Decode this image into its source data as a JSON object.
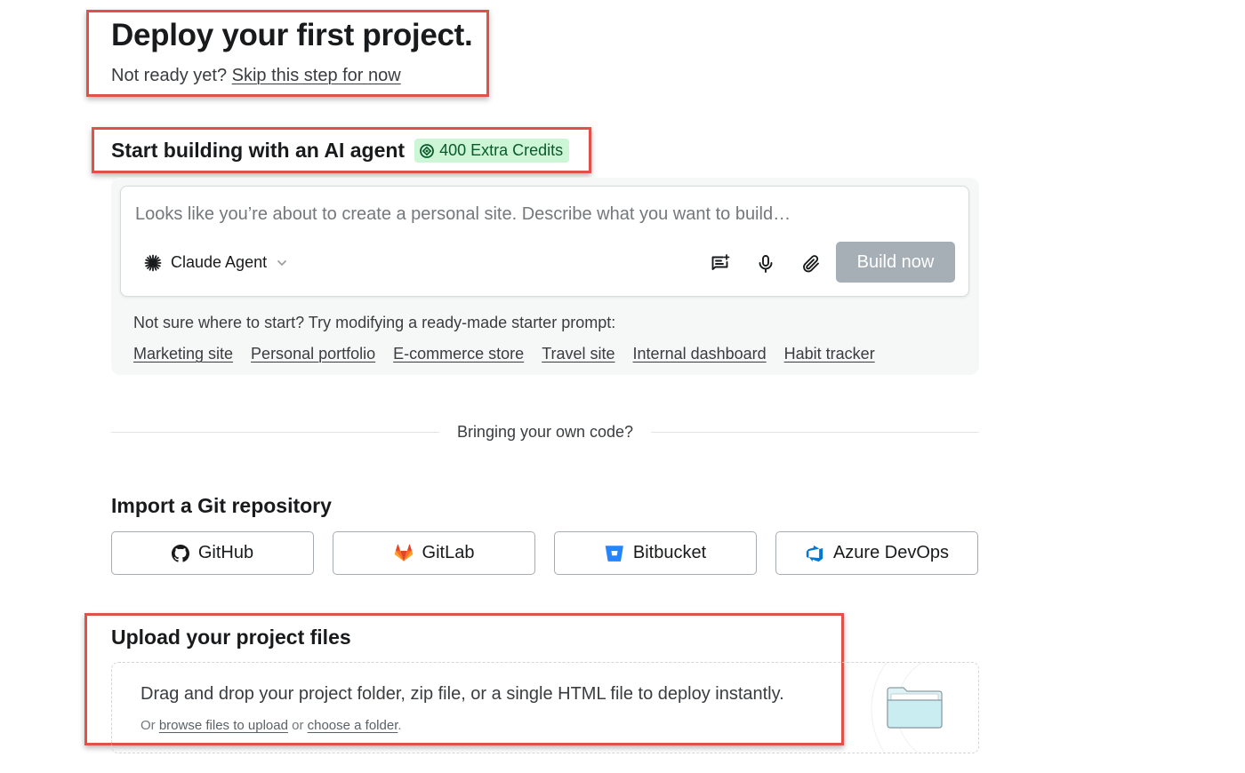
{
  "header": {
    "title": "Deploy your first project.",
    "subtitle_prefix": "Not ready yet? ",
    "skip_link": "Skip this step for now"
  },
  "ai_agent": {
    "heading": "Start building with an AI agent",
    "credits_badge": "400 Extra Credits",
    "badge_icon": "credit-coin-icon",
    "prompt_placeholder": "Looks like you’re about to create a personal site. Describe what you want to build…",
    "agent_name": "Claude Agent",
    "agent_icon": "claude-asterisk-icon",
    "build_button": "Build now",
    "toolbar_icons": [
      "prompt-enhance-icon",
      "microphone-icon",
      "paperclip-icon"
    ],
    "starter_hint": "Not sure where to start? Try modifying a ready-made starter prompt:",
    "starter_prompts": [
      "Marketing site",
      "Personal portfolio",
      "E-commerce store",
      "Travel site",
      "Internal dashboard",
      "Habit tracker"
    ]
  },
  "divider": {
    "text": "Bringing your own code?"
  },
  "git": {
    "heading": "Import a Git repository",
    "providers": [
      {
        "label": "GitHub",
        "icon": "github-icon"
      },
      {
        "label": "GitLab",
        "icon": "gitlab-icon"
      },
      {
        "label": "Bitbucket",
        "icon": "bitbucket-icon"
      },
      {
        "label": "Azure DevOps",
        "icon": "azure-devops-icon"
      }
    ]
  },
  "upload": {
    "heading": "Upload your project files",
    "description": "Drag and drop your project folder, zip file, or a single HTML file to deploy instantly.",
    "sub_prefix": "Or ",
    "browse_link": "browse files to upload",
    "sub_mid": " or ",
    "folder_link": "choose a folder",
    "sub_suffix": ".",
    "art_icon": "folder-icon"
  },
  "colors": {
    "highlight": "#e0514a",
    "badge_bg": "#ccf6d6",
    "badge_text": "#0b5a2b",
    "build_button_bg": "#a6afb6",
    "gitlab_orange": "#e24329",
    "bitbucket_blue": "#2684ff",
    "azure_blue": "#0078d4"
  }
}
